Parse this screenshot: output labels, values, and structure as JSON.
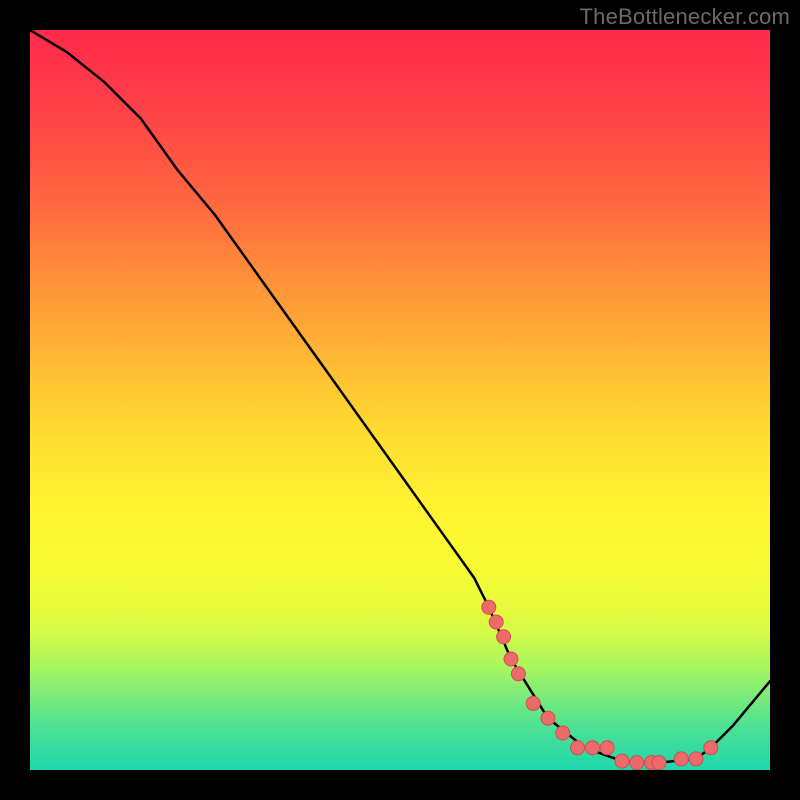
{
  "watermark": "TheBottlenecker.com",
  "colors": {
    "background": "#000000",
    "gradient_top": "#ff2a4a",
    "gradient_bottom": "#1fd6ac",
    "curve_stroke": "#000000",
    "marker_fill": "#ed6a6a",
    "marker_stroke": "#d04f4f"
  },
  "chart_data": {
    "type": "line",
    "title": "",
    "xlabel": "",
    "ylabel": "",
    "xlim": [
      0,
      100
    ],
    "ylim": [
      0,
      100
    ],
    "x": [
      0,
      5,
      10,
      15,
      20,
      25,
      30,
      35,
      40,
      45,
      50,
      55,
      60,
      62,
      65,
      70,
      75,
      80,
      85,
      90,
      92,
      95,
      100
    ],
    "values": [
      100,
      97,
      93,
      88,
      81,
      75,
      68,
      61,
      54,
      47,
      40,
      33,
      26,
      22,
      15,
      7,
      3,
      1.2,
      1.0,
      1.5,
      3,
      6,
      12
    ],
    "markers_x": [
      62,
      63,
      64,
      65,
      66,
      68,
      70,
      72,
      74,
      76,
      78,
      80,
      82,
      84,
      85,
      88,
      90,
      92
    ],
    "markers_y": [
      22,
      20,
      18,
      15,
      13,
      9,
      7,
      5,
      3.0,
      3.0,
      3.0,
      1.2,
      1.0,
      1.0,
      1.0,
      1.5,
      1.5,
      3
    ]
  }
}
